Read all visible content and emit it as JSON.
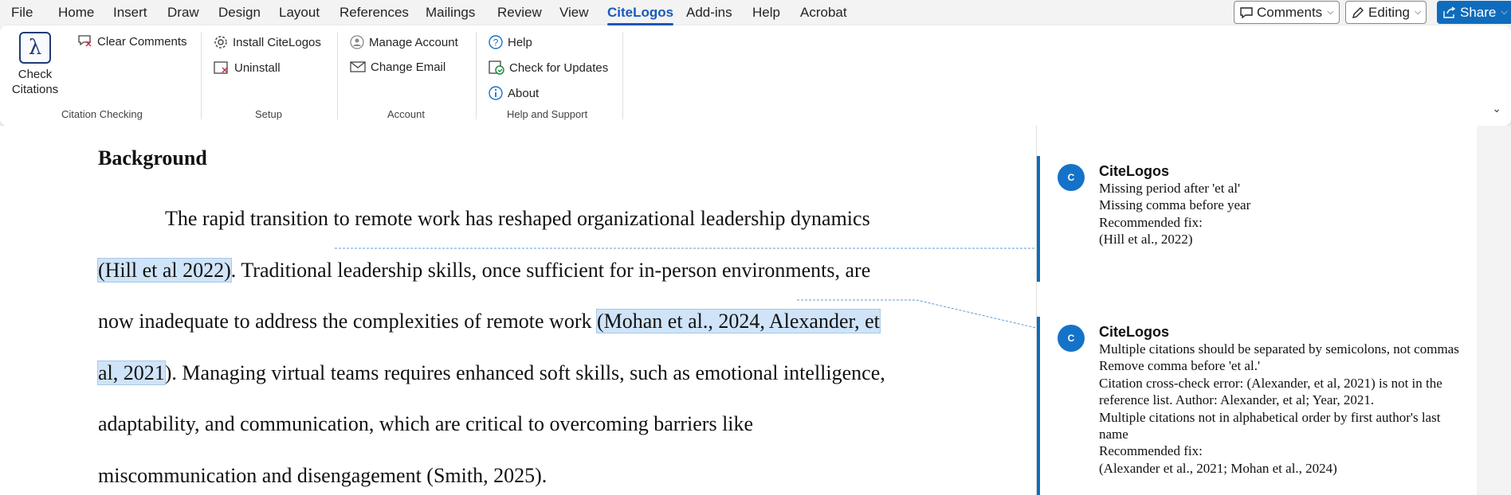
{
  "menu": {
    "tabs": [
      "File",
      "Home",
      "Insert",
      "Draw",
      "Design",
      "Layout",
      "References",
      "Mailings",
      "Review",
      "View",
      "CiteLogos",
      "Add-ins",
      "Help",
      "Acrobat"
    ],
    "comments_label": "Comments",
    "editing_label": "Editing",
    "share_label": "Share"
  },
  "ribbon": {
    "check_citations": "Check Citations",
    "clear_comments": "Clear Comments",
    "install": "Install CiteLogos",
    "uninstall": "Uninstall",
    "manage_account": "Manage Account",
    "change_email": "Change Email",
    "help": "Help",
    "check_updates": "Check for Updates",
    "about": "About",
    "groups": [
      "Citation Checking",
      "Setup",
      "Account",
      "Help and Support"
    ]
  },
  "document": {
    "heading": "Background",
    "p1": "The rapid transition to remote work has reshaped organizational leadership dynamics ",
    "cite1": "(Hill et al 2022)",
    "p2": ". Traditional leadership skills, once sufficient for in-person environments, are now inadequate to address the complexities of remote work ",
    "cite2": "(Mohan et al., 2024, Alexander, et al, 2021",
    "p3": "). Managing virtual teams requires enhanced soft skills, such as emotional intelligence, adaptability, and communication, which are critical to overcoming barriers like miscommunication and disengagement (Smith, 2025)."
  },
  "comments": [
    {
      "avatar": "C",
      "author": "CiteLogos",
      "lines": [
        "Missing period after 'et al'",
        "Missing comma before year",
        "Recommended fix:",
        "(Hill et al., 2022)"
      ]
    },
    {
      "avatar": "C",
      "author": "CiteLogos",
      "lines": [
        "Multiple citations should be separated by semicolons, not commas",
        "Remove comma before 'et al.'",
        "Citation cross-check error: (Alexander, et al, 2021) is not in the reference list. Author: Alexander, et al; Year, 2021.",
        "Multiple citations not in alphabetical order by first author's last name",
        "Recommended fix:",
        "(Alexander et al., 2021; Mohan et al., 2024)"
      ]
    }
  ],
  "colors": {
    "accent": "#185abd",
    "share": "#0f6cbd",
    "highlight": "#cfe4f8"
  }
}
